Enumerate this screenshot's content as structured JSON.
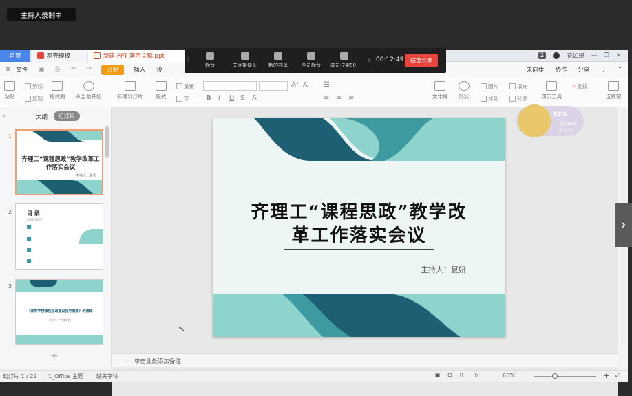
{
  "recording": {
    "badge": "主持人录制中"
  },
  "tabs": {
    "home": "首页",
    "docer": "稻壳模板",
    "file": "新建 PPT 演示文稿.ppt"
  },
  "window_right": {
    "badge_num": "2",
    "user": "花如妍"
  },
  "menu": {
    "file": "文件",
    "start": "开始",
    "insert": "插入",
    "truncated": "设",
    "sync": "未同步",
    "collab": "协作",
    "share": "分享"
  },
  "toolbar": {
    "paste": "粘贴",
    "cut": "剪切",
    "copy": "复制",
    "format_painter": "格式刷",
    "from_current": "从当前开始",
    "new_slide": "新建幻灯片",
    "layout": "版式",
    "section": "节",
    "reset": "重置",
    "textbox": "文本框",
    "shape": "形状",
    "picture": "图片",
    "arrange": "排列",
    "fill": "填充",
    "outline": "轮廓",
    "presentation_tools": "演示工具",
    "find": "查找",
    "select_pane": "选择窗"
  },
  "meeting": {
    "mute": "静音",
    "camera_off": "关闭摄像头",
    "new_share": "新的共享",
    "mute_all": "全员静音",
    "members": "成员(74/80)",
    "time": "00:12:49",
    "end_share": "结束共享"
  },
  "left_panel": {
    "outline_tab": "大纲",
    "slides_tab": "幻灯片",
    "thumbs": [
      {
        "num": "1",
        "title": "齐理工“课程思政”教学改革工作落实会议",
        "sub": "主持人：夏妍"
      },
      {
        "num": "2",
        "title": "目 录",
        "sub": "CONTENTS"
      },
      {
        "num": "3",
        "title": "《高等学校课程思政建设指导纲要》的通知",
        "sub": "主持人：中建单位"
      }
    ]
  },
  "slide": {
    "title_line1": "齐理工“课程思政”教学改",
    "title_line2": "革工作落实会议",
    "host": "主持人：夏妍"
  },
  "widget": {
    "percent": "62%",
    "up": "21.9K/s",
    "down": "6.2K/s"
  },
  "notes": {
    "placeholder": "单击此处添加备注"
  },
  "status": {
    "slide_count": "幻灯片 1 / 22",
    "theme": "1_Office 主题",
    "missing_font": "缺失字体",
    "zoom": "65%"
  },
  "colors": {
    "teal_dark": "#1f5f74",
    "teal_mid": "#3d9aa0",
    "teal_light": "#8fd4cc",
    "accent_orange": "#f39c12",
    "end_share_red": "#e8453c"
  }
}
